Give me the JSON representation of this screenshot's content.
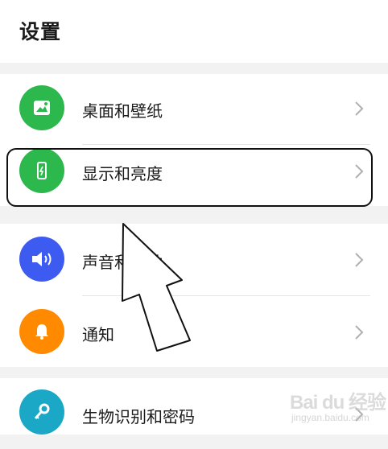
{
  "header": {
    "title": "设置"
  },
  "settings": {
    "items": [
      {
        "label": "桌面和壁纸",
        "icon": "wallpaper-icon",
        "color": "#2db84d"
      },
      {
        "label": "显示和亮度",
        "icon": "display-brightness-icon",
        "color": "#2db84d"
      },
      {
        "label": "声音和振动",
        "icon": "speaker-icon",
        "color": "#3d5bf1"
      },
      {
        "label": "通知",
        "icon": "bell-icon",
        "color": "#ff8a00"
      },
      {
        "label": "生物识别和密码",
        "icon": "key-icon",
        "color": "#1aa8c6"
      }
    ]
  },
  "annotation": {
    "highlight_color": "#111111",
    "arrow": "pointer-arrow-icon"
  },
  "watermark": {
    "brand": "Bai du 经验",
    "url": "jingyan.baidu.com"
  }
}
